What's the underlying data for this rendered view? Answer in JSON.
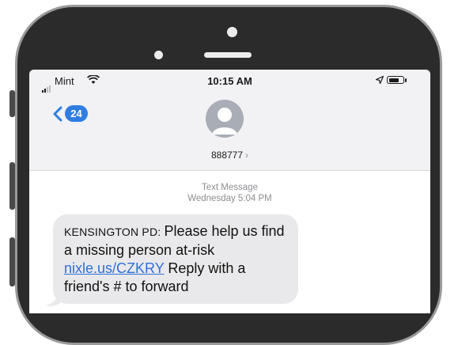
{
  "status_bar": {
    "carrier": "Mint",
    "time": "10:15 AM"
  },
  "nav": {
    "back_count": "24",
    "contact_name": "888777",
    "contact_chevron": "›"
  },
  "conversation": {
    "message_type": "Text Message",
    "timestamp": "Wednesday 5:04 PM",
    "message": {
      "sender_prefix": "KENSINGTON PD: ",
      "text_line1": "Please help us find a missing person at-risk ",
      "link": "nixle.us/CZKRY",
      "text_line2": " Reply with a friend's # to forward"
    }
  },
  "icons": {
    "signal": "signal-bars-icon",
    "wifi": "wifi-icon",
    "location": "location-arrow-icon",
    "battery": "battery-icon",
    "back": "chevron-left-icon",
    "avatar": "person-avatar-icon"
  },
  "colors": {
    "accent": "#2f7de1",
    "bubble": "#e9e9eb",
    "phone_body": "#2b2b2b"
  }
}
